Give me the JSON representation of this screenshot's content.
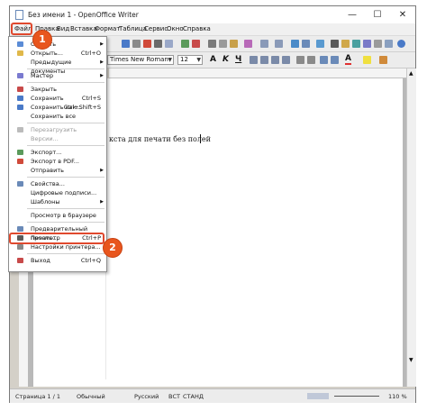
{
  "window": {
    "title": "Без имени 1 - OpenOffice Writer",
    "min_glyph": "—",
    "max_glyph": "☐",
    "close_glyph": "✕"
  },
  "menubar": {
    "items": [
      "Файл",
      "Правка",
      "Вид",
      "Вставка",
      "Формат",
      "Таблица",
      "Сервис",
      "Окно",
      "Справка"
    ]
  },
  "format_toolbar": {
    "font_name": "Times New Roman",
    "font_size": "12"
  },
  "document": {
    "text": "кста для печати без полей"
  },
  "file_menu": {
    "items": [
      {
        "label": "Создать",
        "shortcut": "",
        "submenu": true,
        "disabled": false,
        "icon": "#5b8cd6"
      },
      {
        "label": "Открыть...",
        "shortcut": "Ctrl+O",
        "submenu": false,
        "disabled": false,
        "icon": "#e0b84a"
      },
      {
        "label": "Предыдущие документы",
        "shortcut": "",
        "submenu": true,
        "disabled": false,
        "icon": ""
      },
      {
        "sep": true
      },
      {
        "label": "Мастер",
        "shortcut": "",
        "submenu": true,
        "disabled": false,
        "icon": "#7a7ad0"
      },
      {
        "sep": true
      },
      {
        "label": "Закрыть",
        "shortcut": "",
        "submenu": false,
        "disabled": false,
        "icon": "#c84a4a"
      },
      {
        "label": "Сохранить",
        "shortcut": "Ctrl+S",
        "submenu": false,
        "disabled": false,
        "icon": "#4a7ac8"
      },
      {
        "label": "Сохранить как...",
        "shortcut": "Ctrl+Shift+S",
        "submenu": false,
        "disabled": false,
        "icon": "#4a7ac8"
      },
      {
        "label": "Сохранить все",
        "shortcut": "",
        "submenu": false,
        "disabled": false,
        "icon": ""
      },
      {
        "sep": true
      },
      {
        "label": "Перезагрузить",
        "shortcut": "",
        "submenu": false,
        "disabled": true,
        "icon": "#bbbbbb"
      },
      {
        "label": "Версии...",
        "shortcut": "",
        "submenu": false,
        "disabled": true,
        "icon": ""
      },
      {
        "sep": true
      },
      {
        "label": "Экспорт...",
        "shortcut": "",
        "submenu": false,
        "disabled": false,
        "icon": "#5b9a5b"
      },
      {
        "label": "Экспорт в PDF...",
        "shortcut": "",
        "submenu": false,
        "disabled": false,
        "icon": "#d04a3a"
      },
      {
        "label": "Отправить",
        "shortcut": "",
        "submenu": true,
        "disabled": false,
        "icon": ""
      },
      {
        "sep": true
      },
      {
        "label": "Свойства...",
        "shortcut": "",
        "submenu": false,
        "disabled": false,
        "icon": "#6a8ab8"
      },
      {
        "label": "Цифровые подписи...",
        "shortcut": "",
        "submenu": false,
        "disabled": false,
        "icon": ""
      },
      {
        "label": "Шаблоны",
        "shortcut": "",
        "submenu": true,
        "disabled": false,
        "icon": ""
      },
      {
        "sep": true
      },
      {
        "label": "Просмотр в браузере",
        "shortcut": "",
        "submenu": false,
        "disabled": false,
        "icon": ""
      },
      {
        "sep": true
      },
      {
        "label": "Предварительный просмотр",
        "shortcut": "",
        "submenu": false,
        "disabled": false,
        "icon": "#6a8ab8"
      },
      {
        "label": "Печать...",
        "shortcut": "Ctrl+P",
        "submenu": false,
        "disabled": false,
        "icon": "#5a5a5a"
      },
      {
        "label": "Настройки принтера...",
        "shortcut": "",
        "submenu": false,
        "disabled": false,
        "icon": "#8a8a8a"
      },
      {
        "sep": true
      },
      {
        "label": "Выход",
        "shortcut": "Ctrl+Q",
        "submenu": false,
        "disabled": false,
        "icon": "#c84a4a"
      }
    ]
  },
  "callouts": {
    "step1": "1",
    "step2": "2",
    "accent": "#e0492e"
  },
  "status": {
    "page": "Страница 1 / 1",
    "style": "Обычный",
    "language": "Русский",
    "insert": "ВСТ",
    "mode": "СТАНД",
    "zoom": "110 %"
  }
}
